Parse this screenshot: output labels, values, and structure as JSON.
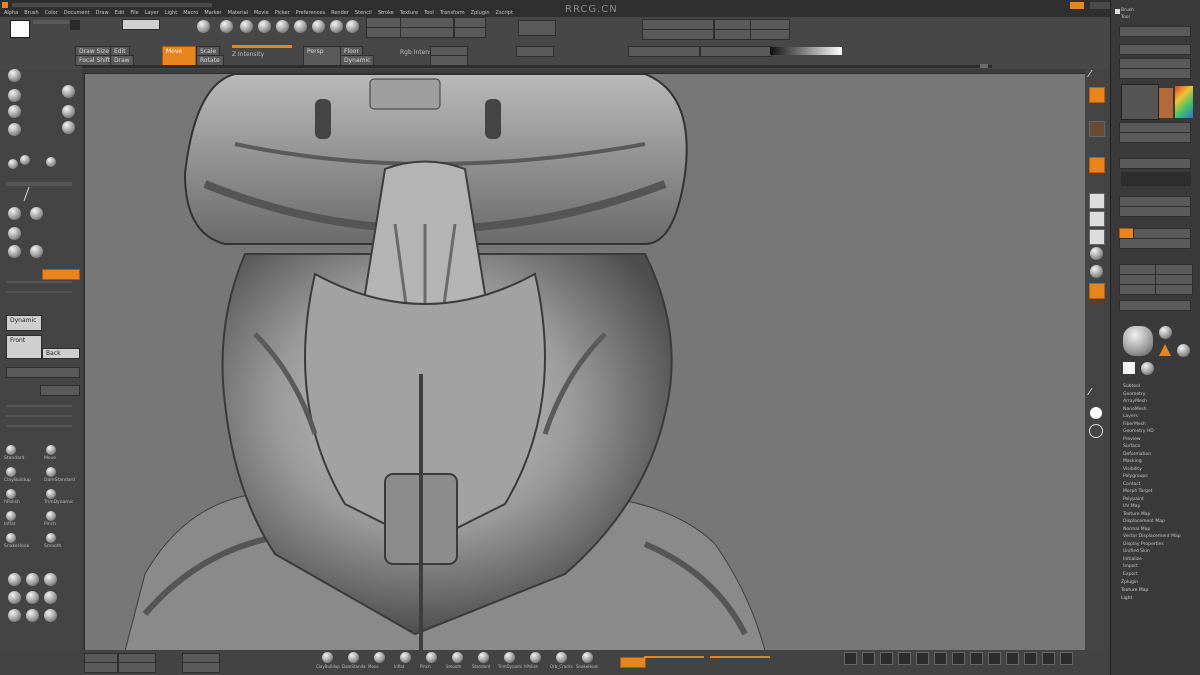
{
  "watermark": "RRCG.CN",
  "app_menu": [
    "Alpha",
    "Brush",
    "Color",
    "Document",
    "Draw",
    "Edit",
    "File",
    "Layer",
    "Light",
    "Macro",
    "Marker",
    "Material",
    "Movie",
    "Picker",
    "Preferences",
    "Render",
    "Stencil",
    "Stroke",
    "Texture",
    "Tool",
    "Transform",
    "Zplugin",
    "Zscript"
  ],
  "top_shelf": {
    "btn_a": "Draw Size",
    "btn_b": "Focal Shift",
    "btn_c": "Z Intensity",
    "btn_d": "Rgb Intensity",
    "btn_e": "Persp",
    "btn_f": "Floor",
    "btn_g": "Dynamic",
    "btn_h": "Edit",
    "btn_i": "Draw",
    "btn_j": "Move",
    "btn_k": "Scale",
    "btn_l": "Rotate"
  },
  "left_shelf": {
    "brushes": [
      "Standard",
      "Move",
      "ClayBuildup",
      "DamStandard",
      "hPolish",
      "TrimDynamic",
      "Inflat",
      "Pinch",
      "SnakeHook",
      "Smooth"
    ],
    "panel_a": "Dynamic",
    "panel_b": "Front",
    "panel_c": "Back"
  },
  "right_shelf": {
    "icons": [
      "move-tool-icon",
      "zoom-icon",
      "rotate-icon",
      "frame-icon",
      "transp-icon",
      "solo-icon",
      "xpose-icon"
    ]
  },
  "tray": {
    "header": "Brush",
    "subheader": "Tool",
    "items": [
      "Subtool",
      "Geometry",
      "ArrayMesh",
      "NanoMesh",
      "Layers",
      "FiberMesh",
      "Geometry HD",
      "Preview",
      "Surface",
      "Deformation",
      "Masking",
      "Visibility",
      "Polygroups",
      "Contact",
      "Morph Target",
      "Polypaint",
      "UV Map",
      "Texture Map",
      "Displacement Map",
      "Normal Map",
      "Vector Displacement Map",
      "Display Properties",
      "Unified Skin",
      "Initialize",
      "Import",
      "Export"
    ],
    "footer": [
      "Zplugin",
      "Texture Map",
      "Light"
    ]
  },
  "bottom_shelf": {
    "brushes": [
      "ClayBuildup",
      "DamStandard",
      "Move",
      "Inflat",
      "Pinch",
      "Smooth",
      "Standard",
      "TrimDynamic",
      "hPolish",
      "Orb_Cracks",
      "SnakeHook"
    ]
  }
}
